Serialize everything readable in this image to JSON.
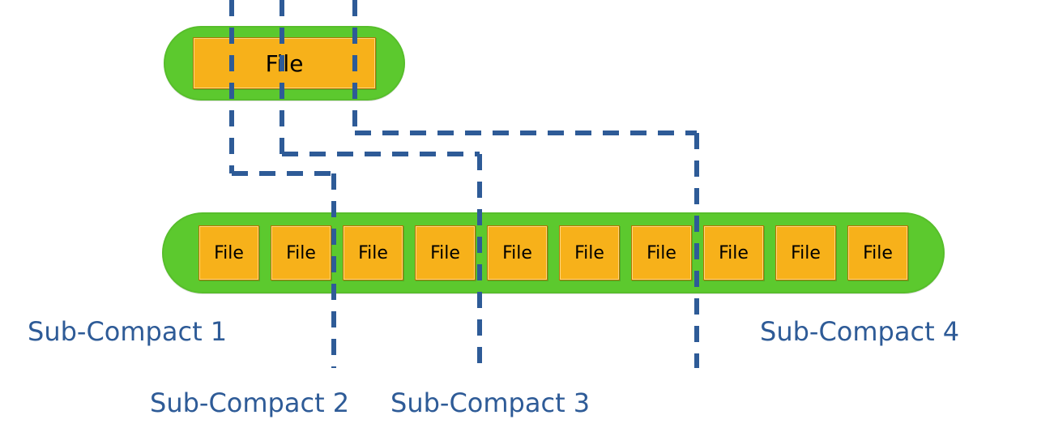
{
  "diagram": {
    "top_file_label": "File",
    "bottom_files": [
      "File",
      "File",
      "File",
      "File",
      "File",
      "File",
      "File",
      "File",
      "File",
      "File"
    ],
    "labels": {
      "sub1": "Sub-Compact 1",
      "sub2": "Sub-Compact 2",
      "sub3": "Sub-Compact 3",
      "sub4": "Sub-Compact 4"
    },
    "partitions": {
      "description": "Dashed blue lines partition the bottom row of 10 files into 4 sub-compaction groups.",
      "groups": [
        {
          "name": "Sub-Compact 1",
          "file_indices": [
            0,
            1
          ]
        },
        {
          "name": "Sub-Compact 2",
          "file_indices": [
            2,
            3
          ]
        },
        {
          "name": "Sub-Compact 3",
          "file_indices": [
            4,
            5,
            6
          ]
        },
        {
          "name": "Sub-Compact 4",
          "file_indices": [
            7,
            8,
            9
          ]
        }
      ]
    },
    "colors": {
      "pill_green": "#5cc92e",
      "file_orange": "#f7b11a",
      "dash_blue": "#2e5b97",
      "label_blue": "#2e5b97"
    }
  }
}
